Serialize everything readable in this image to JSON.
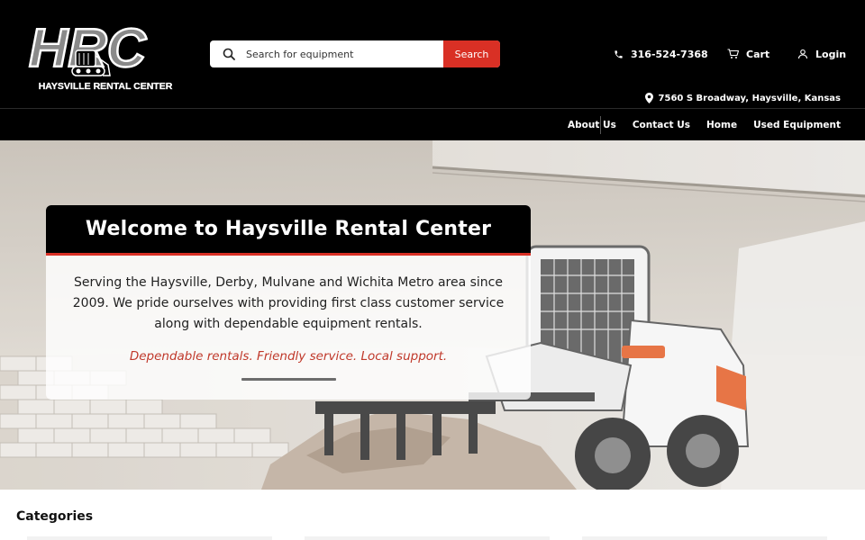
{
  "logo": {
    "letters": "HRC",
    "name": "HAYSVILLE RENTAL CENTER"
  },
  "search": {
    "placeholder": "Search for equipment",
    "value": "",
    "button_label": "Search"
  },
  "header": {
    "phone": "316-524-7368",
    "cart_label": "Cart",
    "login_label": "Login",
    "address": "7560 S Broadway, Haysville, Kansas"
  },
  "nav": {
    "items": [
      {
        "label": "About Us"
      },
      {
        "label": "Contact Us"
      },
      {
        "label": "Home"
      },
      {
        "label": "Used Equipment"
      }
    ]
  },
  "hero": {
    "title": "Welcome to Haysville Rental Center",
    "text": "Serving the Haysville, Derby, Mulvane and Wichita Metro area since 2009. We pride ourselves with providing first class customer service along with dependable equipment rentals.",
    "tagline": "Dependable rentals. Friendly service. Local support."
  },
  "categories": {
    "title": "Categories"
  },
  "colors": {
    "accent": "#d93025",
    "header_bg": "#000000",
    "tagline": "#c0392b"
  },
  "icons": [
    "search-icon",
    "phone-icon",
    "cart-icon",
    "user-icon",
    "map-pin-icon"
  ]
}
